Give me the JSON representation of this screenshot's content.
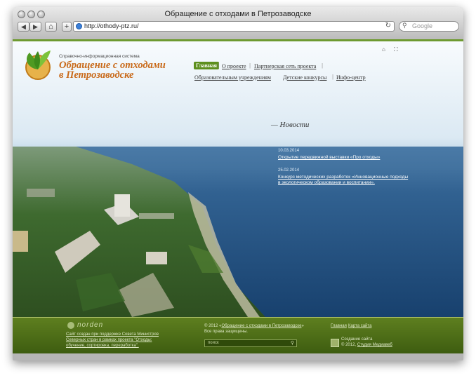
{
  "browser": {
    "title": "Обращение с отходами в Петрозаводске",
    "url": "http://othody-ptz.ru/",
    "search_placeholder": "Google",
    "back_icon": "◀",
    "forward_icon": "▶",
    "home_icon": "⌂",
    "add_icon": "+",
    "reload_icon": "↻",
    "search_icon": "⚲"
  },
  "site": {
    "logo_small": "Справочно-информационная система",
    "logo_line1": "Обращение с отходами",
    "logo_line2": "в Петрозаводске",
    "header_icons": {
      "home": "⌂",
      "sitemap": "⛶"
    },
    "nav": {
      "home": "Главная",
      "about": "О проекте",
      "partners": "Партнерская сеть проекта",
      "education": "Образовательным учреждениям",
      "kids": "Детские конкурсы",
      "info": "Инфо-центр",
      "separator": "|"
    },
    "news": {
      "title": "— Новости",
      "items": [
        {
          "date": "10.03.2014",
          "text": "Открытие передвижной выставки «Про отходы»"
        },
        {
          "date": "25.02.2014",
          "line1": "Конкурс методических разработок «Инновационные подходы",
          "line2": "в экологическом образовании и воспитании»."
        }
      ]
    }
  },
  "footer": {
    "norden": "norden",
    "support_line1": "Сайт создан при поддержке Совета Министров",
    "support_line2": "Северных стран в рамках проекта \"Отходы:",
    "support_line3": "обучение, сортировка, переработка\".",
    "copyright_prefix": "© 2012 «",
    "copyright_link": "Обращение с отходами в Петрозаводске",
    "copyright_suffix": "»",
    "rights": "Все права защищены.",
    "search_placeholder": "поиск",
    "search_icon": "⚲",
    "link_home": "Главная",
    "link_sitemap": "Карта сайта",
    "studio_line1": "Создание сайта",
    "studio_prefix": "© 2012, ",
    "studio_link": "Студия Медиавеб"
  },
  "colors": {
    "accent_green": "#5d8f1d",
    "logo_orange": "#c96a1a",
    "footer_green": "#4d6e18"
  }
}
